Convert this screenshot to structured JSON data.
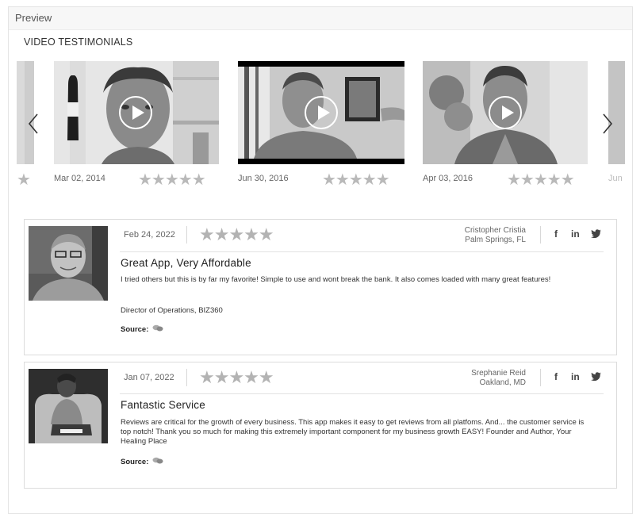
{
  "preview": {
    "label": "Preview"
  },
  "section": {
    "title": "VIDEO TESTIMONIALS"
  },
  "carousel": {
    "slides": [
      {
        "date": "Mar 02, 2014",
        "stars": "★★★★★"
      },
      {
        "date": "Jun 30, 2016",
        "stars": "★★★★★"
      },
      {
        "date": "Apr 03, 2016",
        "stars": "★★★★★"
      }
    ],
    "partial_right_date": "Jun",
    "partial_left_star": "★"
  },
  "reviews": [
    {
      "date": "Feb 24, 2022",
      "stars": "★★★★★",
      "name": "Cristopher Cristia",
      "location": "Palm Springs, FL",
      "title": "Great App, Very Affordable",
      "body": "I tried others but this is by far my favorite! Simple to use and wont break the bank. It also comes loaded with many great features!",
      "role": "Director of Operations, BIZ360",
      "source_label": "Source:"
    },
    {
      "date": "Jan 07, 2022",
      "stars": "★★★★★",
      "name": "Srephanie Reid",
      "location": "Oakland, MD",
      "title": "Fantastic Service",
      "body": "Reviews are critical for the growth of every business. This app makes it easy to get reviews from all platfoms. And... the customer service is top notch! Thank you so much for making this extremely important component for my business growth EASY! Founder and Author, Your Healing Place",
      "role": "",
      "source_label": "Source:"
    }
  ],
  "social": {
    "facebook": "f",
    "linkedin": "in",
    "twitter": "t"
  },
  "icons": {
    "play": "play-icon",
    "prev": "chevron-left-icon",
    "next": "chevron-right-icon",
    "source": "chat-bubbles-icon"
  }
}
